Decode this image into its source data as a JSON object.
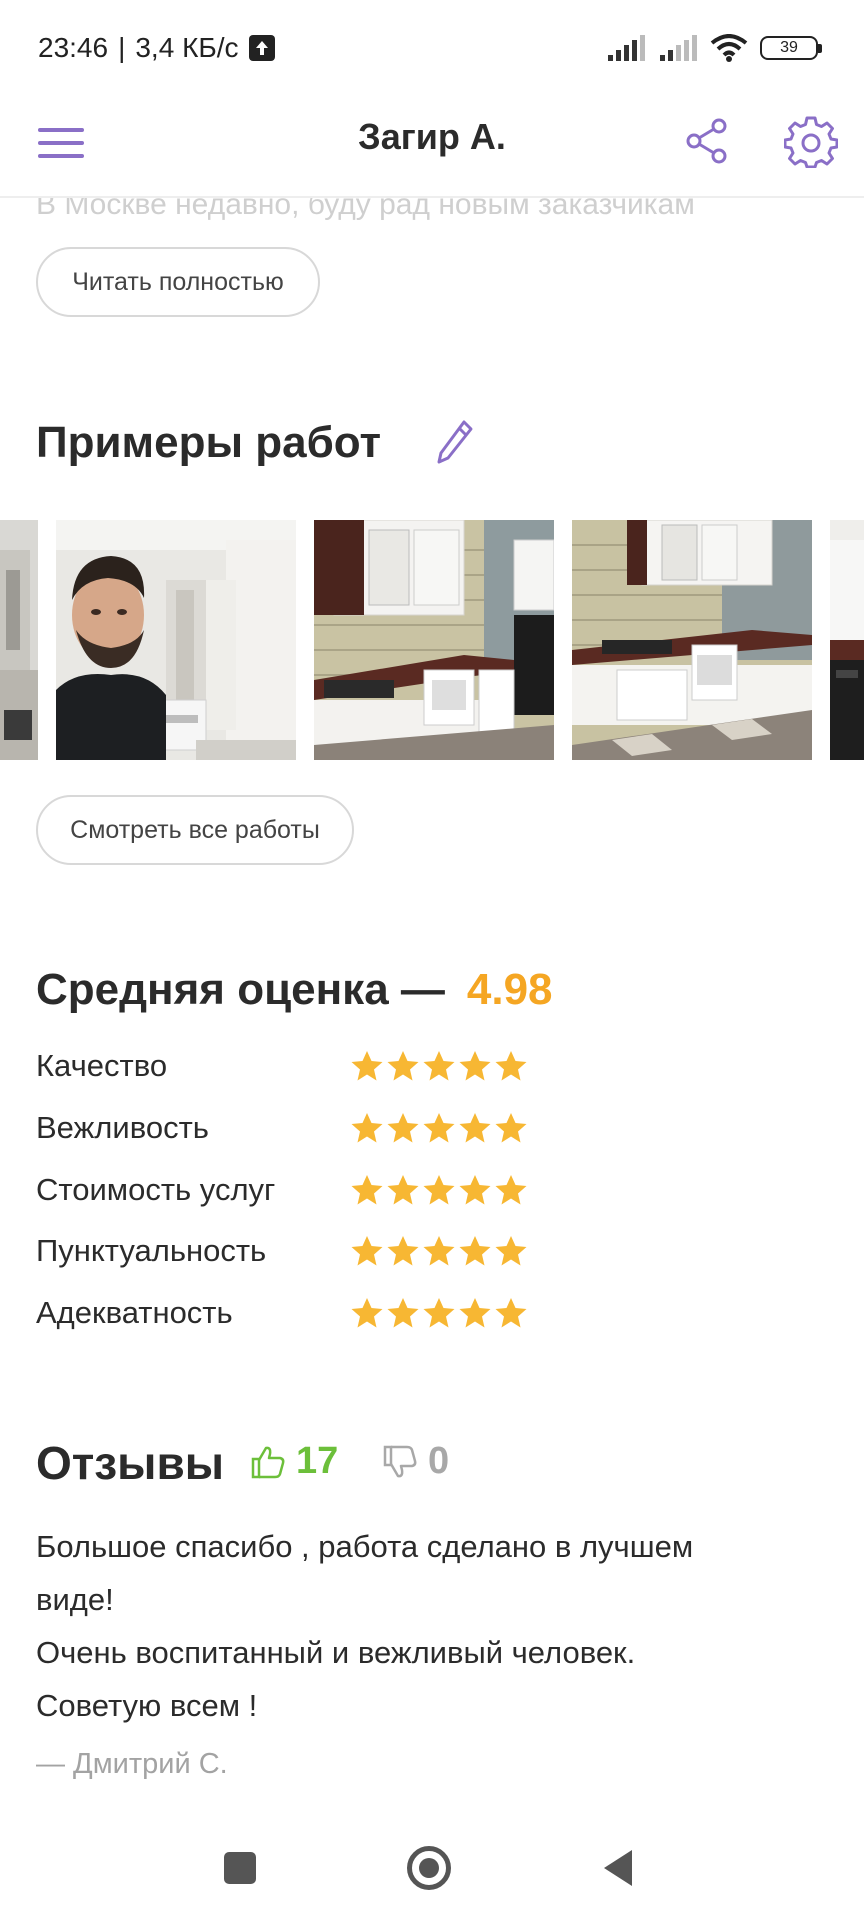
{
  "status_bar": {
    "time": "23:46",
    "separator": "|",
    "network_speed": "3,4 КБ/с",
    "battery": "39",
    "icons": [
      "upload-icon",
      "signal-icon",
      "signal-icon",
      "wifi-icon",
      "battery-icon"
    ]
  },
  "header": {
    "title": "Загир А.",
    "menu_icon": "hamburger-menu-icon",
    "share_icon": "share-icon",
    "settings_icon": "gear-icon",
    "accent_color": "#8a6fc7"
  },
  "about": {
    "text_fragment": "В Москве недавно, буду рад новым заказчикам",
    "read_more_label": "Читать полностью"
  },
  "portfolio": {
    "title": "Примеры работ",
    "edit_icon": "pencil-icon",
    "photos": [
      {
        "name": "room-interior-partial"
      },
      {
        "name": "selfie-in-apartment"
      },
      {
        "name": "kitchen-white-cabinets"
      },
      {
        "name": "kitchen-white-cabinets-angle"
      },
      {
        "name": "kitchen-oven-partial"
      }
    ],
    "view_all_label": "Смотреть все работы"
  },
  "rating": {
    "title": "Средняя оценка —",
    "average": "4.98",
    "average_color": "#f5a623",
    "star_color": "#f7b733",
    "criteria": [
      {
        "label": "Качество",
        "stars": 5
      },
      {
        "label": "Вежливость",
        "stars": 5
      },
      {
        "label": "Стоимость услуг",
        "stars": 5
      },
      {
        "label": "Пунктуальность",
        "stars": 5
      },
      {
        "label": "Адекватность",
        "stars": 5
      }
    ]
  },
  "reviews": {
    "title": "Отзывы",
    "likes": "17",
    "dislikes": "0",
    "likes_color": "#6cbf3a",
    "dislikes_color": "#a8a8a8",
    "latest": {
      "text_lines": [
        "Большое спасибо , работа сделано в лучшем",
        "виде!",
        "Очень воспитанный и вежливый человек.",
        "Советую всем !"
      ],
      "author": "— Дмитрий С."
    }
  },
  "nav_bar": {
    "icons": [
      "recent-apps-icon",
      "home-icon",
      "back-icon"
    ]
  }
}
